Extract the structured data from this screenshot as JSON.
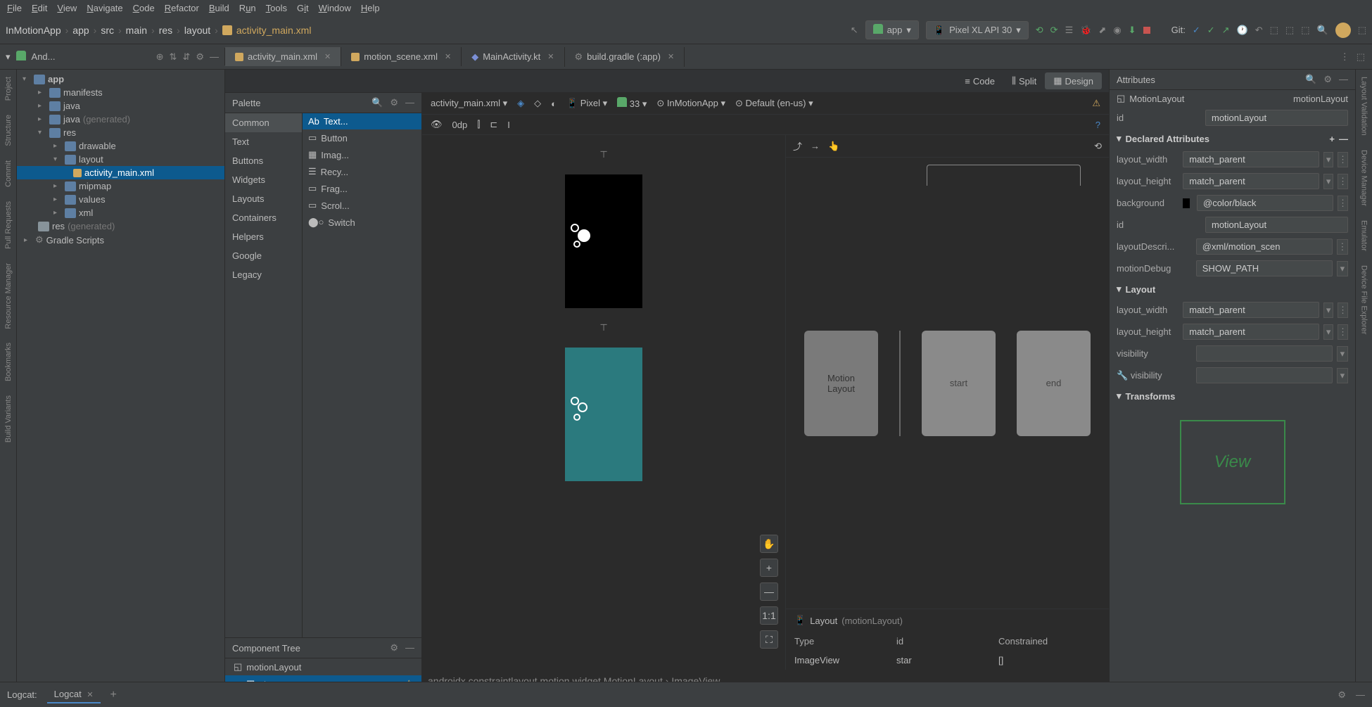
{
  "menu": {
    "file": "File",
    "edit": "Edit",
    "view": "View",
    "navigate": "Navigate",
    "code": "Code",
    "refactor": "Refactor",
    "build": "Build",
    "run": "Run",
    "tools": "Tools",
    "git": "Git",
    "window": "Window",
    "help": "Help"
  },
  "breadcrumb": {
    "p0": "InMotionApp",
    "p1": "app",
    "p2": "src",
    "p3": "main",
    "p4": "res",
    "p5": "layout",
    "p6": "activity_main.xml"
  },
  "toolbar": {
    "run_config": "app",
    "device": "Pixel XL API 30",
    "git": "Git:"
  },
  "project_header": {
    "label": "And..."
  },
  "tabs": {
    "t0": "activity_main.xml",
    "t1": "motion_scene.xml",
    "t2": "MainActivity.kt",
    "t3": "build.gradle (:app)"
  },
  "view_switch": {
    "code": "Code",
    "split": "Split",
    "design": "Design"
  },
  "tree": {
    "app": "app",
    "manifests": "manifests",
    "java": "java",
    "java_gen_a": "java",
    "java_gen_b": "(generated)",
    "res": "res",
    "drawable": "drawable",
    "layout": "layout",
    "activity_main": "activity_main.xml",
    "mipmap": "mipmap",
    "values": "values",
    "xml": "xml",
    "res_gen_a": "res",
    "res_gen_b": "(generated)",
    "gradle": "Gradle Scripts"
  },
  "palette": {
    "title": "Palette",
    "cats": {
      "common": "Common",
      "text": "Text",
      "buttons": "Buttons",
      "widgets": "Widgets",
      "layouts": "Layouts",
      "containers": "Containers",
      "helpers": "Helpers",
      "google": "Google",
      "legacy": "Legacy"
    },
    "items": {
      "textview": "Text...",
      "button": "Button",
      "image": "Imag...",
      "recycler": "Recy...",
      "fragment": "Frag...",
      "scroll": "Scrol...",
      "switch": "Switch"
    }
  },
  "component_tree": {
    "title": "Component Tree",
    "root": "motionLayout",
    "child": "star"
  },
  "canvas": {
    "file": "activity_main.xml",
    "pixel": "Pixel",
    "api": "33",
    "app": "InMotionApp",
    "locale": "Default (en-us)",
    "dp": "0dp"
  },
  "motion": {
    "ml": "Motion\nLayout",
    "start": "start",
    "end": "end"
  },
  "layout_panel": {
    "title": "Layout",
    "scope": "(motionLayout)",
    "h_type": "Type",
    "h_id": "id",
    "h_constr": "Constrained",
    "r_type": "ImageView",
    "r_id": "star",
    "r_constr": "[]"
  },
  "bc_bottom": {
    "p0": "androidx.constraintlayout.motion.widget.MotionLayout",
    "p1": "ImageView"
  },
  "attrs": {
    "title": "Attributes",
    "type": "MotionLayout",
    "name": "motionLayout",
    "id_label": "id",
    "id_val": "motionLayout",
    "declared": "Declared Attributes",
    "lw": "layout_width",
    "lw_v": "match_parent",
    "lh": "layout_height",
    "lh_v": "match_parent",
    "bg": "background",
    "bg_v": "@color/black",
    "id2": "id",
    "id2_v": "motionLayout",
    "ld": "layoutDescri...",
    "ld_v": "@xml/motion_scen",
    "md": "motionDebug",
    "md_v": "SHOW_PATH",
    "layout": "Layout",
    "lw2": "layout_width",
    "lw2_v": "match_parent",
    "lh2": "layout_height",
    "lh2_v": "match_parent",
    "vis": "visibility",
    "vis2": "visibility",
    "transforms": "Transforms",
    "view": "View"
  },
  "sidebars": {
    "project": "Project",
    "structure": "Structure",
    "commit": "Commit",
    "pull": "Pull Requests",
    "resmgr": "Resource Manager",
    "bookmarks": "Bookmarks",
    "buildv": "Build Variants",
    "layoutv": "Layout Validation",
    "devmgr": "Device Manager",
    "emulator": "Emulator",
    "devexp": "Device File Explorer"
  },
  "bottom": {
    "logcat_l": "Logcat:",
    "logcat": "Logcat"
  },
  "zoom": {
    "ratio": "1:1"
  }
}
